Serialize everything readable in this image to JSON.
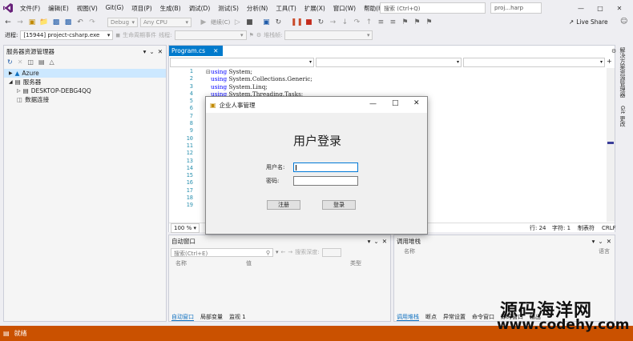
{
  "menubar": {
    "items": [
      "文件(F)",
      "编辑(E)",
      "视图(V)",
      "Git(G)",
      "项目(P)",
      "生成(B)",
      "调试(D)",
      "测试(S)",
      "分析(N)",
      "工具(T)",
      "扩展(X)",
      "窗口(W)",
      "帮助(H)"
    ],
    "search_placeholder": "搜索 (Ctrl+Q)",
    "solution_name": "proj...harp",
    "live_share": "Live Share"
  },
  "toolbar1": {
    "config": "Debug",
    "platform": "Any CPU",
    "continue": "继续(C)"
  },
  "toolbar2": {
    "process_label": "进程:",
    "process_value": "[15944] project-csharp.exe",
    "lifecycle": "生命周期事件",
    "thread_label": "线程:",
    "stackframe_label": "堆栈帧:"
  },
  "server_explorer": {
    "title": "服务器资源管理器",
    "items": [
      {
        "label": "Azure",
        "selected": true
      },
      {
        "label": "服务器"
      },
      {
        "label": "DESKTOP-DEBG4QQ"
      },
      {
        "label": "数据连接"
      }
    ]
  },
  "editor": {
    "tab_label": "Program.cs",
    "line_numbers": [
      "1",
      "2",
      "3",
      "4",
      "5",
      "6",
      "7",
      "8",
      "9",
      "10",
      "11",
      "12",
      "13",
      "14",
      "15",
      "16",
      "17",
      "18",
      "19"
    ],
    "code": {
      "l1": " System;",
      "l2": " System.Collections.Generic;",
      "l3": " System.Linq;",
      "l4": " System.Threading.Tasks;",
      "kw": "using"
    },
    "zoom": "100 %",
    "row": "行: 24",
    "col": "字符: 1",
    "tabs_mode": "制表符",
    "eol": "CRLF"
  },
  "autos": {
    "title": "自动窗口",
    "search_placeholder": "搜索(Ctrl+E)",
    "search_depth": "搜索深度:",
    "col_name": "名称",
    "col_value": "值",
    "col_type": "类型",
    "tabs": [
      "自动窗口",
      "局部变量",
      "监视 1"
    ]
  },
  "callstack": {
    "title": "调用堆栈",
    "col_name": "名称",
    "col_lang": "语言",
    "tabs": [
      "调用堆栈",
      "断点",
      "异常设置",
      "命令窗口",
      "即时窗口",
      "输出"
    ]
  },
  "right_strip": {
    "tabs": [
      "解决方案资源管理器",
      "Git 更改"
    ]
  },
  "dialog": {
    "title": "企业人事管理",
    "heading": "用户登录",
    "username_label": "用户名:",
    "password_label": "密码:",
    "register_button": "注册",
    "login_button": "登录"
  },
  "statusbar": {
    "text": "就绪"
  },
  "watermark": {
    "line1": "源码海洋网",
    "line2": "www.codehy.com"
  },
  "colors": {
    "accent": "#007acc",
    "statusbar": "#ca5100",
    "vs_purple": "#68217a"
  }
}
